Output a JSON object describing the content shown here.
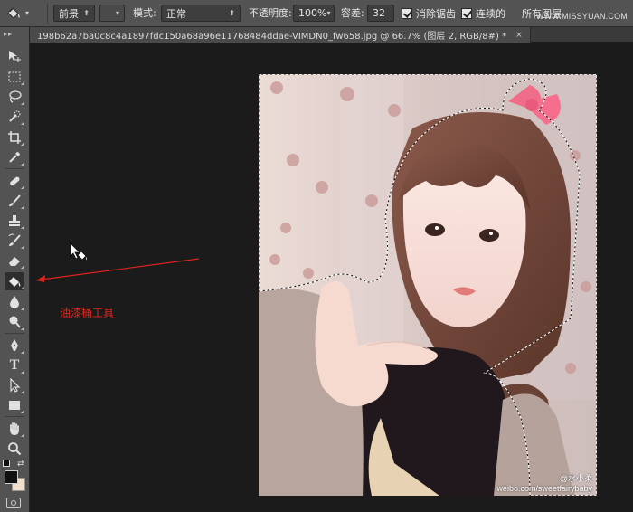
{
  "options_bar": {
    "tool_preset_icon": "paint-bucket-icon",
    "fill_source": "前景",
    "pattern_swatch": "",
    "mode_label": "模式:",
    "mode_value": "正常",
    "opacity_label": "不透明度:",
    "opacity_value": "100%",
    "tolerance_label": "容差:",
    "tolerance_value": "32",
    "anti_alias_label": "消除锯齿",
    "contiguous_label": "连续的",
    "all_layers_label": "所有图层",
    "site_watermark": "WWW.MISSYUAN.COM",
    "site_watermark_prefix": "思缘设计论坛"
  },
  "document_tab": {
    "title": "198b62a7ba0c8c4a1897fdc150a68a96e11768484ddae-VIMDN0_fw658.jpg @ 66.7% (图层 2, RGB/8#) *",
    "close_glyph": "×"
  },
  "toolbox": {
    "items": [
      {
        "name": "move-tool",
        "icon": "move-icon"
      },
      {
        "name": "marquee-tool",
        "icon": "rect-marquee-icon"
      },
      {
        "name": "lasso-tool",
        "icon": "lasso-icon"
      },
      {
        "name": "quick-select-tool",
        "icon": "quick-select-icon"
      },
      {
        "name": "crop-tool",
        "icon": "crop-icon"
      },
      {
        "name": "eyedropper-tool",
        "icon": "eyedropper-icon"
      },
      {
        "name": "healing-brush-tool",
        "icon": "bandage-icon"
      },
      {
        "name": "brush-tool",
        "icon": "brush-icon"
      },
      {
        "name": "stamp-tool",
        "icon": "stamp-icon"
      },
      {
        "name": "history-brush-tool",
        "icon": "history-brush-icon"
      },
      {
        "name": "eraser-tool",
        "icon": "eraser-icon"
      },
      {
        "name": "paint-bucket-tool",
        "icon": "paint-bucket-icon",
        "active": true
      },
      {
        "name": "blur-tool",
        "icon": "drop-icon"
      },
      {
        "name": "dodge-tool",
        "icon": "dodge-icon"
      },
      {
        "name": "pen-tool",
        "icon": "pen-icon"
      },
      {
        "name": "type-tool",
        "icon": "type-icon",
        "glyph": "T"
      },
      {
        "name": "path-select-tool",
        "icon": "path-select-icon"
      },
      {
        "name": "shape-tool",
        "icon": "rectangle-icon"
      },
      {
        "name": "hand-tool",
        "icon": "hand-icon"
      },
      {
        "name": "zoom-tool",
        "icon": "zoom-icon"
      }
    ],
    "foreground_color": "#111111",
    "background_color": "#f2e0cc"
  },
  "annotation": {
    "label": "油漆桶工具",
    "color": "#e0231c"
  },
  "photo": {
    "watermark_line1": "@水小柔",
    "watermark_line2": "weibo.com/sweetfairybaby"
  },
  "colors": {
    "ui_panel": "#535353",
    "canvas_bg": "#1b1b1b",
    "accent_red": "#e0231c"
  }
}
